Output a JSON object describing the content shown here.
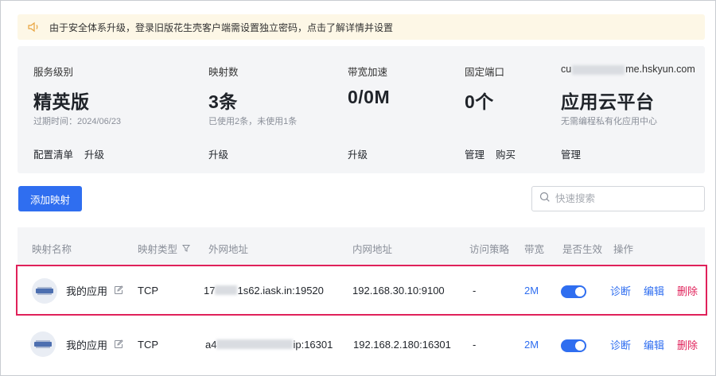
{
  "notice": {
    "text": "由于安全体系升级，登录旧版花生壳客户端需设置独立密码，点击了解详情并设置"
  },
  "stats": {
    "service": {
      "label": "服务级别",
      "value": "精英版",
      "sub": "过期时间：2024/06/23",
      "actions": [
        "配置清单",
        "升级"
      ]
    },
    "mappings": {
      "label": "映射数",
      "value": "3条",
      "sub": "已使用2条，未使用1条",
      "actions": [
        "升级"
      ]
    },
    "bandwidth": {
      "label": "带宽加速",
      "value": "0/0M",
      "actions": [
        "升级"
      ]
    },
    "ports": {
      "label": "固定端口",
      "value": "0个",
      "actions": [
        "管理",
        "购买"
      ]
    },
    "cloud": {
      "label_prefix": "cu",
      "label_suffix": "me.hskyun.com",
      "value": "应用云平台",
      "sub": "无需编程私有化应用中心",
      "actions": [
        "管理"
      ]
    }
  },
  "toolbar": {
    "add_label": "添加映射",
    "search_placeholder": "快速搜索"
  },
  "table": {
    "headers": [
      "映射名称",
      "映射类型",
      "外网地址",
      "内网地址",
      "访问策略",
      "带宽",
      "是否生效",
      "操作"
    ],
    "rows": [
      {
        "name": "我的应用",
        "type": "TCP",
        "ext_prefix": "17",
        "ext_suffix": "1s62.iask.in:19520",
        "internal": "192.168.30.10:9100",
        "policy": "-",
        "bandwidth": "2M",
        "enabled": true,
        "actions": [
          "诊断",
          "编辑",
          "删除"
        ]
      },
      {
        "name": "我的应用",
        "type": "TCP",
        "ext_prefix": "a4",
        "ext_suffix": "ip:16301",
        "internal": "192.168.2.180:16301",
        "policy": "-",
        "bandwidth": "2M",
        "enabled": true,
        "actions": [
          "诊断",
          "编辑",
          "删除"
        ]
      }
    ]
  },
  "colors": {
    "accent": "#2f6ef0",
    "danger": "#e0215a",
    "notice_bg": "#fdf7e6",
    "panel_bg": "#f4f5f7"
  }
}
